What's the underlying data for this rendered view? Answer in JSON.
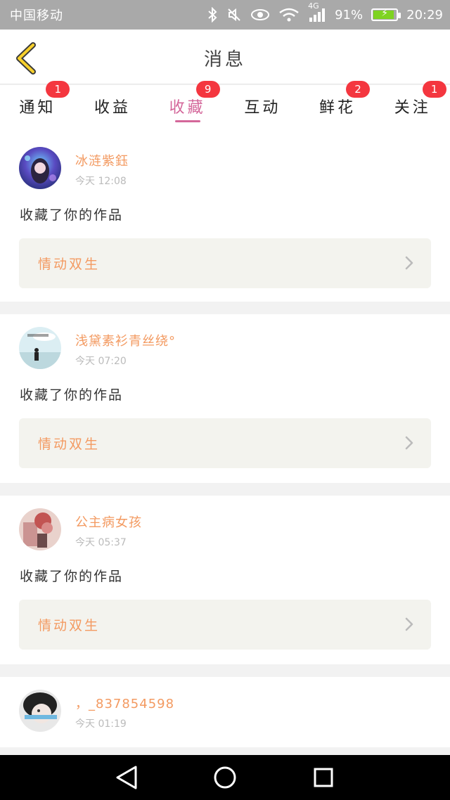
{
  "status_bar": {
    "carrier": "中国移动",
    "network": "4G",
    "battery": "91%",
    "battery_level": 0.91,
    "time": "20:29"
  },
  "header": {
    "title": "消息"
  },
  "tabs": [
    {
      "label": "通知",
      "badge": "1"
    },
    {
      "label": "收益",
      "badge": ""
    },
    {
      "label": "收藏",
      "badge": "9",
      "active": true
    },
    {
      "label": "互动",
      "badge": ""
    },
    {
      "label": "鲜花",
      "badge": "2"
    },
    {
      "label": "关注",
      "badge": "1"
    }
  ],
  "colors": {
    "accent": "#d4679a",
    "username": "#f39a61",
    "badge": "#f4363f"
  },
  "feed": [
    {
      "username": "冰涟紫鈺",
      "time": "今天 12:08",
      "action": "收藏了你的作品",
      "work": "情动双生"
    },
    {
      "username": "浅黛素衫青丝绕°",
      "time": "今天 07:20",
      "action": "收藏了你的作品",
      "work": "情动双生"
    },
    {
      "username": "公主病女孩",
      "time": "今天 05:37",
      "action": "收藏了你的作品",
      "work": "情动双生"
    },
    {
      "username": "，_837854598",
      "time": "今天 01:19"
    }
  ]
}
